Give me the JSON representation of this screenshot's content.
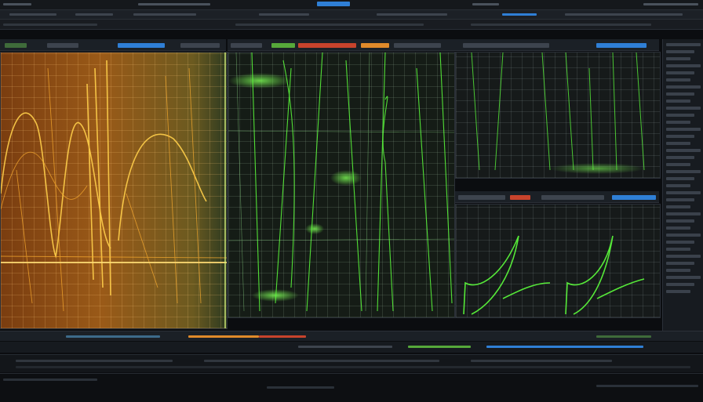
{
  "app": {
    "top_center_badge": "",
    "status_text": ""
  },
  "colors": {
    "accent_blue": "#2f7fd6",
    "accent_orange": "#e08a2a",
    "accent_green": "#56d23a",
    "accent_red": "#c8432c",
    "panel_border": "#2b3038"
  },
  "panels": {
    "left_scope": {
      "label": "",
      "trace_color": "#ffcf4a"
    },
    "center_scope": {
      "label": "",
      "trace_color": "#5cff3c"
    },
    "right_top_scope": {
      "label": "",
      "trace_color": "#5cff3c"
    },
    "right_bottom_scope": {
      "label": "",
      "trace_color": "#5cff3c"
    }
  },
  "icons": [
    "cursor-icon"
  ]
}
